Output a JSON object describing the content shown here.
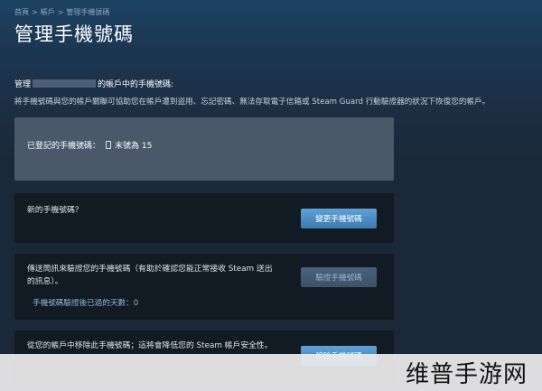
{
  "breadcrumb": {
    "home": "首頁",
    "account": "帳戶",
    "current": "管理手機號碼",
    "separator": ">"
  },
  "page": {
    "title": "管理手機號碼",
    "intro_prefix": "管理",
    "intro_suffix": "的帳戶中的手機號碼:",
    "intro_description": "將手機號碼與您的帳戶關聯可協助您在帳戶遭到盜用、忘記密碼、無法存取電子信箱或 Steam Guard 行動驗證器的狀況下恢復您的帳戶。"
  },
  "phone": {
    "label": "已登記的手機號碼：",
    "icon": "phone-icon",
    "value": "末號為 15"
  },
  "new_number": {
    "text": "新的手機號碼？",
    "button": "變更手機號碼"
  },
  "verify": {
    "text": "傳送簡訊來驗證您的手機號碼（有助於確認您能正常接收 Steam 送出的訊息）。",
    "days_label": "手機號碼驗證後已過的天數：",
    "days_value": "0",
    "button": "驗證手機號碼"
  },
  "remove": {
    "text": "從您的帳戶中移除此手機號碼；這將會降低您的 Steam 帳戶安全性。",
    "button": "移除手機號碼"
  },
  "watermark": {
    "text": "维普手游网"
  },
  "colors": {
    "background": "#1b2838",
    "panel": "#121a24",
    "phone_panel": "#4a5869",
    "button": "#4f8fc9",
    "link": "#8fb8d0"
  }
}
